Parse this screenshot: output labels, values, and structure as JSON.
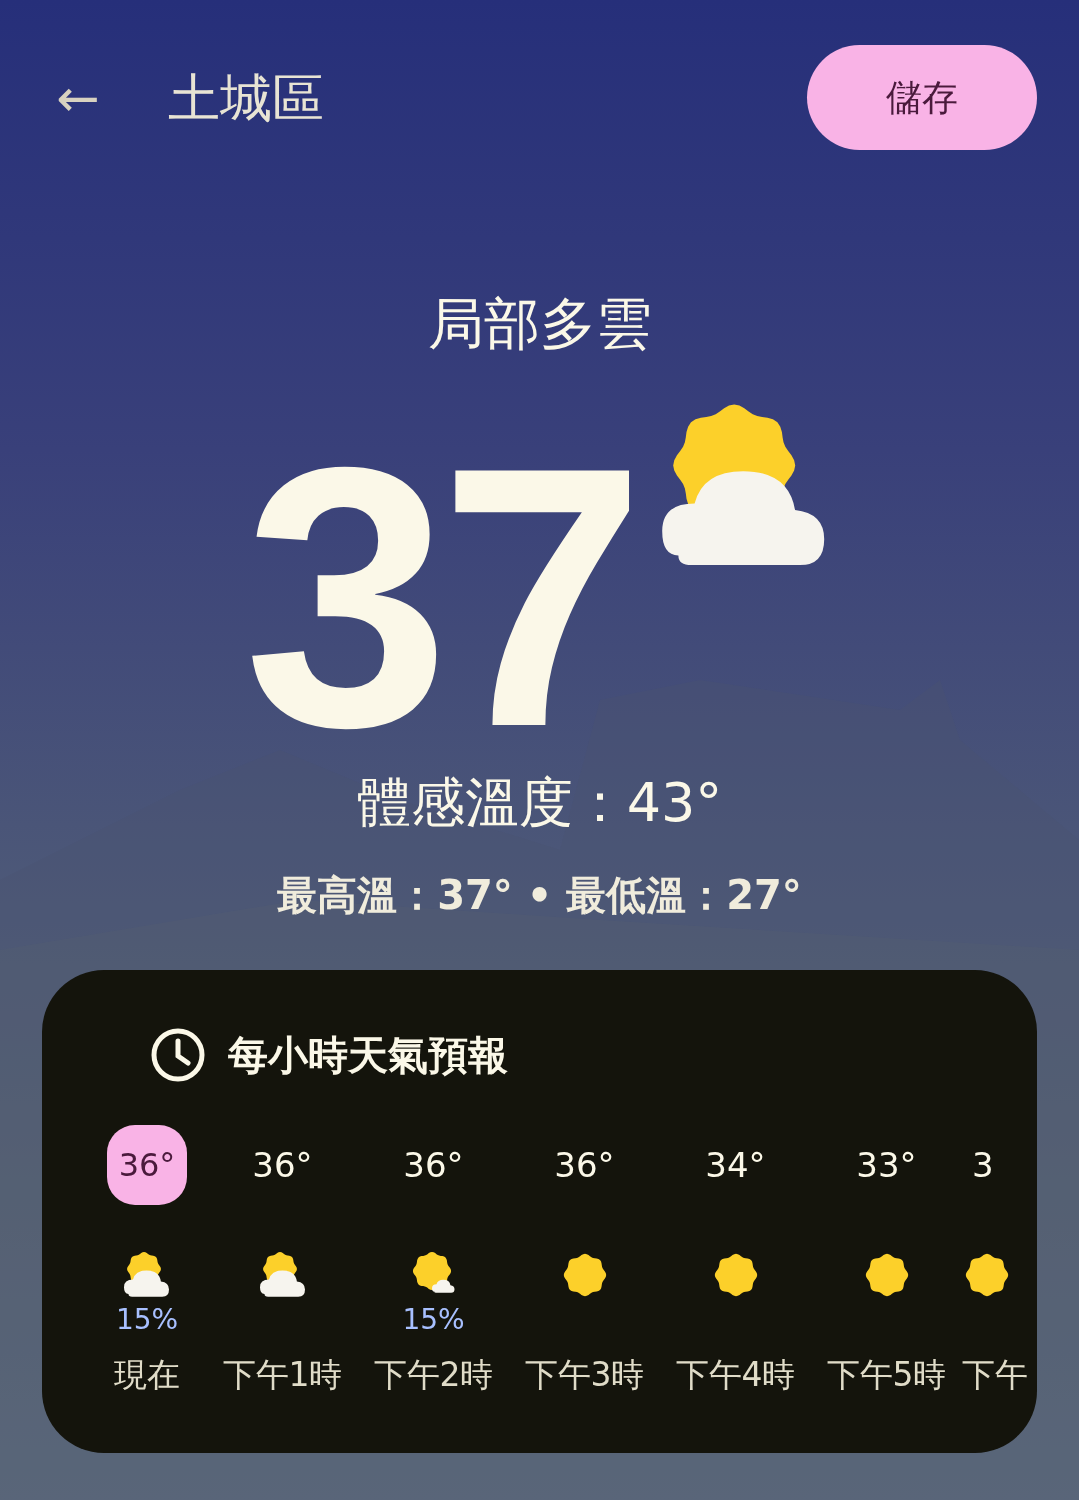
{
  "header": {
    "back": "←",
    "title": "土城區",
    "save_button": "儲存"
  },
  "current": {
    "condition": "局部多雲",
    "kind": "partly_cloudy",
    "temperature": "37",
    "feels_like": "體感溫度：43°",
    "high_low": "最高溫：37° • 最低溫：27°"
  },
  "hourly": {
    "title": "每小時天氣預報",
    "items": [
      {
        "temp": "36°",
        "kind": "partly_cloudy",
        "precip": "15%",
        "label": "現在",
        "selected": true
      },
      {
        "temp": "36°",
        "kind": "partly_cloudy",
        "label": "下午1時",
        "selected": false
      },
      {
        "temp": "36°",
        "kind": "mostly_sunny",
        "precip": "15%",
        "label": "下午2時",
        "selected": false
      },
      {
        "temp": "36°",
        "kind": "sunny",
        "label": "下午3時",
        "selected": false
      },
      {
        "temp": "34°",
        "kind": "sunny",
        "label": "下午4時",
        "selected": false
      },
      {
        "temp": "33°",
        "kind": "sunny",
        "label": "下午5時",
        "selected": false
      },
      {
        "temp": "3",
        "kind": "sunny",
        "label": "下午",
        "selected": false
      }
    ]
  }
}
